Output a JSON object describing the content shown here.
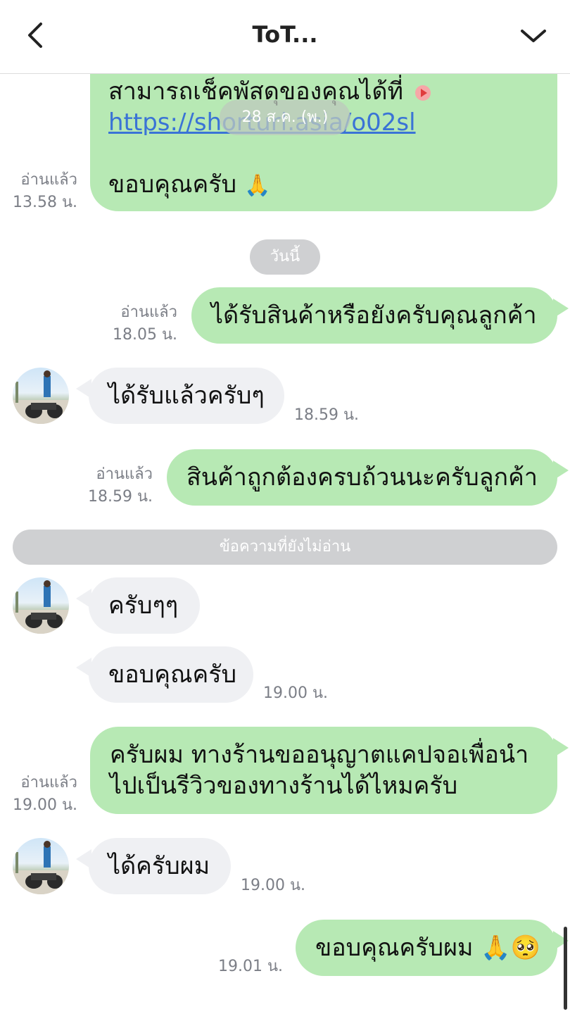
{
  "header": {
    "title": "ToT..."
  },
  "icons": {
    "back": "chevron-left-icon",
    "collapse": "chevron-down-icon"
  },
  "colors": {
    "out_bubble": "#b7e9b4",
    "in_bubble": "#eff0f3",
    "pill": "#cfd0d2",
    "link": "#3a73d6"
  },
  "dates": {
    "floating": "28 ส.ค. (พ.)",
    "today": "วันนี้"
  },
  "unread_divider": "ข้อความที่ยังไม่อ่าน",
  "messages": [
    {
      "dir": "out",
      "line1": "สามารถเช็คพัสดุของคุณได้ที่",
      "link": "https://shorturl.asia/o02sl",
      "line3": "ขอบคุณครับ",
      "read": "อ่านแล้ว",
      "time": "13.58 น."
    },
    {
      "dir": "out",
      "text": "ได้รับสินค้าหรือยังครับคุณลูกค้า",
      "read": "อ่านแล้ว",
      "time": "18.05 น."
    },
    {
      "dir": "in",
      "text": "ได้รับแล้วครับๆ",
      "time": "18.59 น."
    },
    {
      "dir": "out",
      "text": "สินค้าถูกต้องครบถ้วนนะครับลูกค้า",
      "read": "อ่านแล้ว",
      "time": "18.59 น."
    },
    {
      "dir": "in",
      "text": "ครับๆๆ"
    },
    {
      "dir": "in",
      "text": "ขอบคุณครับ",
      "time": "19.00 น."
    },
    {
      "dir": "out",
      "line1": "ครับผม ทางร้านขออนุญาตแคปจอเพื่อนำ",
      "line2": "ไปเป็นรีวิวของทางร้านได้ไหมครับ",
      "read": "อ่านแล้ว",
      "time": "19.00 น."
    },
    {
      "dir": "in",
      "text": "ได้ครับผม",
      "time": "19.00 น."
    },
    {
      "dir": "out",
      "text": "ขอบคุณครับผม 🙏🥺",
      "time": "19.01 น."
    }
  ]
}
